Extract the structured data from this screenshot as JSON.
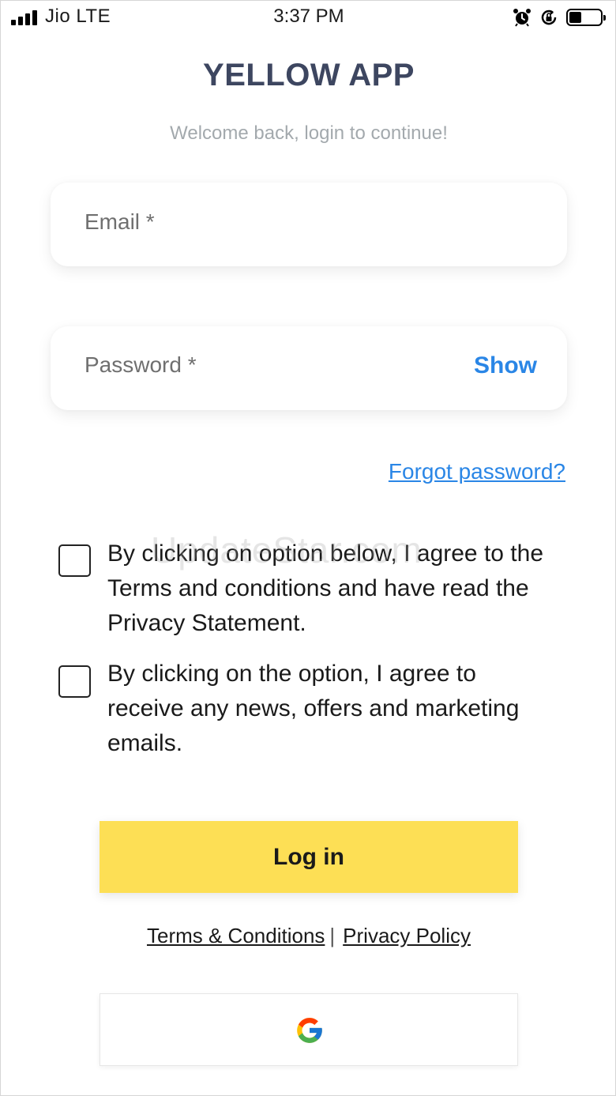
{
  "status_bar": {
    "carrier": "Jio LTE",
    "time": "3:37 PM",
    "icons": [
      "signal-icon",
      "alarm-icon",
      "rotation-lock-icon",
      "battery-icon"
    ],
    "battery_level": 0.4
  },
  "header": {
    "title": "YELLOW APP",
    "subtitle": "Welcome back, login to continue!"
  },
  "form": {
    "email_label": "Email *",
    "password_label": "Password *",
    "show_label": "Show",
    "forgot_label": "Forgot password?"
  },
  "consents": [
    {
      "text": "By clicking on option below, I agree to the Terms and conditions and have read the Privacy Statement.",
      "checked": false
    },
    {
      "text": "By clicking on the option, I agree to receive any news, offers and marketing emails.",
      "checked": false
    }
  ],
  "watermark": "UpdateStar.com",
  "login_label": "Log in",
  "footer": {
    "terms_label": "Terms & Conditions",
    "separator": "|",
    "privacy_label": "Privacy Policy"
  },
  "social": {
    "icon": "google-icon"
  },
  "colors": {
    "accent_blue": "#2a86e6",
    "button_yellow": "#fddf55",
    "title_color": "#3d4660"
  }
}
